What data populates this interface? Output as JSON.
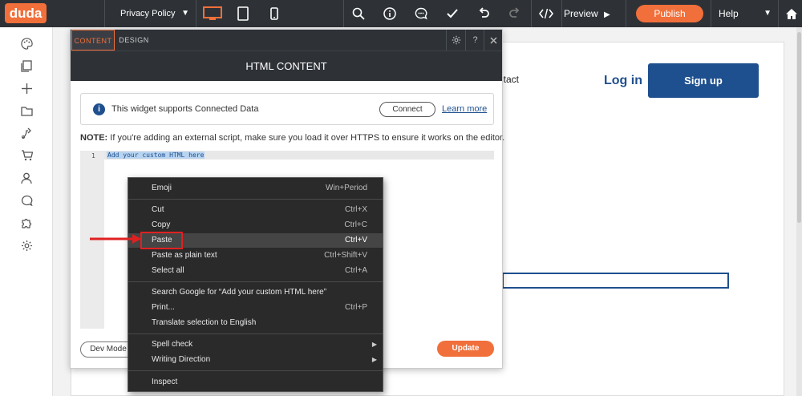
{
  "topbar": {
    "logo": "duda",
    "page_name": "Privacy Policy",
    "preview_label": "Preview",
    "publish_label": "Publish",
    "help_label": "Help",
    "icons": [
      "desktop-icon",
      "tablet-icon",
      "mobile-icon",
      "search-icon",
      "info-icon",
      "comment-icon",
      "check-icon",
      "undo-icon",
      "redo-icon",
      "code-icon",
      "home-icon"
    ],
    "accent": "#f16f3a"
  },
  "sidebar": {
    "icons": [
      "palette-icon",
      "pages-icon",
      "add-icon",
      "folder-icon",
      "share-icon",
      "cart-icon",
      "user-icon",
      "chat-icon",
      "puzzle-icon",
      "settings-icon"
    ]
  },
  "site": {
    "contact_label": "ntact",
    "login_label": "Log in",
    "signup_label": "Sign up",
    "brand_color": "#1e4f8e"
  },
  "panel": {
    "tab_content": "CONTENT",
    "tab_design": "DESIGN",
    "help_btn": "?",
    "title": "HTML CONTENT",
    "info_text": "This widget supports Connected Data",
    "connect_label": "Connect",
    "learn_more": "Learn more",
    "note_label": "NOTE:",
    "note_text": " If you're adding an external script, make sure you load it over HTTPS to ensure it works on the editor.",
    "line_number": "1",
    "code": "Add your custom HTML here",
    "dev_mode": "Dev Mode",
    "update": "Update"
  },
  "context_menu": {
    "items": [
      {
        "label": "Emoji",
        "shortcut": "Win+Period"
      },
      {
        "label": "Cut",
        "shortcut": "Ctrl+X"
      },
      {
        "label": "Copy",
        "shortcut": "Ctrl+C"
      },
      {
        "label": "Paste",
        "shortcut": "Ctrl+V"
      },
      {
        "label": "Paste as plain text",
        "shortcut": "Ctrl+Shift+V"
      },
      {
        "label": "Select all",
        "shortcut": "Ctrl+A"
      },
      {
        "label": "Search Google for “Add your custom HTML here”",
        "shortcut": ""
      },
      {
        "label": "Print...",
        "shortcut": "Ctrl+P"
      },
      {
        "label": "Translate selection to English",
        "shortcut": ""
      },
      {
        "label": "Spell check",
        "shortcut": ""
      },
      {
        "label": "Writing Direction",
        "shortcut": ""
      },
      {
        "label": "Inspect",
        "shortcut": ""
      }
    ],
    "highlighted": "Paste"
  }
}
